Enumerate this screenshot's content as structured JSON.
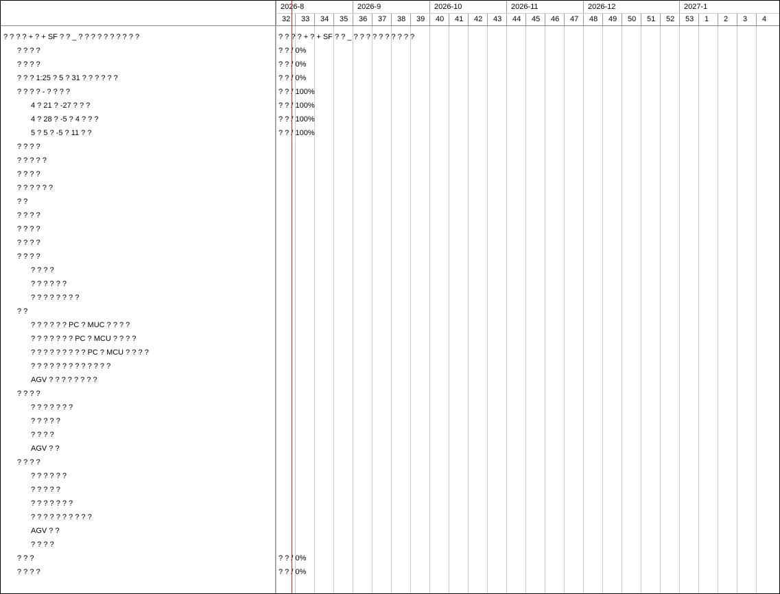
{
  "months": [
    {
      "label": "2026-8",
      "weeks": 4
    },
    {
      "label": "2026-9",
      "weeks": 4
    },
    {
      "label": "2026-10",
      "weeks": 4
    },
    {
      "label": "2026-11",
      "weeks": 4
    },
    {
      "label": "2026-12",
      "weeks": 5
    },
    {
      "label": "2027-1",
      "weeks": 4
    }
  ],
  "weeks": [
    "32",
    "33",
    "34",
    "35",
    "36",
    "37",
    "38",
    "39",
    "40",
    "41",
    "42",
    "43",
    "44",
    "45",
    "46",
    "47",
    "48",
    "49",
    "50",
    "51",
    "52",
    "53",
    "1",
    "2",
    "3",
    "4"
  ],
  "tasks": [
    {
      "name": "? ? ? ? + ? + SF ? ? _ ? ? ? ? ? ? ? ? ? ?",
      "level": 0,
      "bar": "? ? ? ? + ? + SF ? ? _ ? ? ? ? ? ? ? ? ? ?"
    },
    {
      "name": "? ? ? ?",
      "level": 1,
      "bar": "? ?  /  0%"
    },
    {
      "name": "? ? ? ?",
      "level": 1,
      "bar": "? ?  /  0%"
    },
    {
      "name": "? ? ? 1:25 ? 5 ? 31 ? ? ? ? ? ?",
      "level": 1,
      "bar": "? ?  /  0%"
    },
    {
      "name": "? ? ? ? - ? ? ? ?",
      "level": 1,
      "bar": "? ?  /  100%"
    },
    {
      "name": "4 ? 21 ? -27 ? ? ?",
      "level": 2,
      "bar": "? ?  /  100%"
    },
    {
      "name": "4 ? 28 ? -5 ? 4 ? ? ?",
      "level": 2,
      "bar": "? ?  /  100%"
    },
    {
      "name": "5 ? 5 ? -5 ? 11 ? ?",
      "level": 2,
      "bar": "? ?  /  100%"
    },
    {
      "name": "? ? ? ?",
      "level": 1,
      "bar": ""
    },
    {
      "name": "? ? ? ? ?",
      "level": 1,
      "bar": ""
    },
    {
      "name": "? ? ? ?",
      "level": 1,
      "bar": ""
    },
    {
      "name": "? ? ? ? ? ?",
      "level": 1,
      "bar": ""
    },
    {
      "name": "? ?",
      "level": 1,
      "bar": ""
    },
    {
      "name": "? ? ? ?",
      "level": 1,
      "bar": ""
    },
    {
      "name": "? ? ? ?",
      "level": 1,
      "bar": ""
    },
    {
      "name": "? ? ? ?",
      "level": 1,
      "bar": ""
    },
    {
      "name": "? ? ? ?",
      "level": 1,
      "bar": ""
    },
    {
      "name": "? ? ? ?",
      "level": 2,
      "bar": ""
    },
    {
      "name": "? ? ? ? ? ?",
      "level": 2,
      "bar": ""
    },
    {
      "name": "? ? ? ? ? ? ? ?",
      "level": 2,
      "bar": ""
    },
    {
      "name": "? ?",
      "level": 1,
      "bar": ""
    },
    {
      "name": "? ? ? ? ? ? PC ? MUC ? ? ? ?",
      "level": 2,
      "bar": ""
    },
    {
      "name": "? ? ? ? ? ? ? PC ? MCU ? ? ? ?",
      "level": 2,
      "bar": ""
    },
    {
      "name": "? ? ? ? ? ? ? ? ? PC ? MCU ? ? ? ?",
      "level": 2,
      "bar": ""
    },
    {
      "name": "? ? ? ? ? ? ? ? ? ? ? ? ?",
      "level": 2,
      "bar": ""
    },
    {
      "name": "AGV ? ? ? ? ? ? ? ?",
      "level": 2,
      "bar": ""
    },
    {
      "name": "? ? ? ?",
      "level": 1,
      "bar": ""
    },
    {
      "name": "? ? ? ? ? ? ?",
      "level": 2,
      "bar": ""
    },
    {
      "name": "? ? ? ? ?",
      "level": 2,
      "bar": ""
    },
    {
      "name": "? ? ? ?",
      "level": 2,
      "bar": ""
    },
    {
      "name": "AGV ? ?",
      "level": 2,
      "bar": ""
    },
    {
      "name": "? ? ? ?",
      "level": 1,
      "bar": ""
    },
    {
      "name": "? ? ? ? ? ?",
      "level": 2,
      "bar": ""
    },
    {
      "name": "? ? ? ? ?",
      "level": 2,
      "bar": ""
    },
    {
      "name": "? ? ? ? ? ? ?",
      "level": 2,
      "bar": ""
    },
    {
      "name": "? ? ? ? ? ? ? ? ? ?",
      "level": 2,
      "bar": ""
    },
    {
      "name": "AGV ? ?",
      "level": 2,
      "bar": ""
    },
    {
      "name": "? ? ? ?",
      "level": 2,
      "bar": ""
    },
    {
      "name": "? ? ?",
      "level": 1,
      "bar": "? ?  /  0%"
    },
    {
      "name": "? ? ? ?",
      "level": 1,
      "bar": "? ?  /  0%"
    }
  ],
  "colors": {
    "today_line": "#e02020",
    "grid_line": "#cccccc",
    "border": "#888888"
  }
}
